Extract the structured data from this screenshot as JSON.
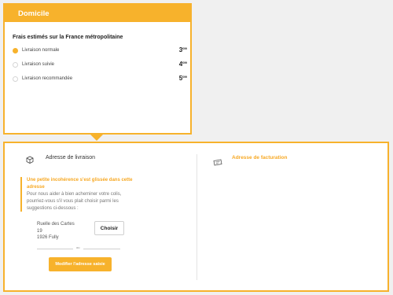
{
  "domicile": {
    "header": "Domicile",
    "subtitle": "Frais estimés sur la France métropolitaine",
    "options": [
      {
        "label": "Livraison normale",
        "price_main": "3",
        "price_cents": "€99",
        "selected": true
      },
      {
        "label": "Livraison suivie",
        "price_main": "4",
        "price_cents": "€99",
        "selected": false
      },
      {
        "label": "Livraison recommandée",
        "price_main": "5",
        "price_cents": "€99",
        "selected": false
      }
    ]
  },
  "shipping": {
    "icon": "package-icon",
    "title": "Adresse de livraison",
    "warning_title": "Une petite incohérence s'est glissée dans cette adresse",
    "warning_text": "Pour nous aider à bien acheminer votre colis, pourriez-vous s'il vous plait choisir parmi les suggestions ci-dessous :",
    "address_lines": [
      "Ruelle des Cartes",
      "19",
      "1926 Fully"
    ],
    "choose_label": "Choisir",
    "or_label": "ou",
    "modify_label": "Modifier l'adresse saisie"
  },
  "billing": {
    "icon": "ticket-icon",
    "title": "Adresse de facturation"
  },
  "colors": {
    "accent": "#f7b22c",
    "background": "#f0f0f0"
  }
}
